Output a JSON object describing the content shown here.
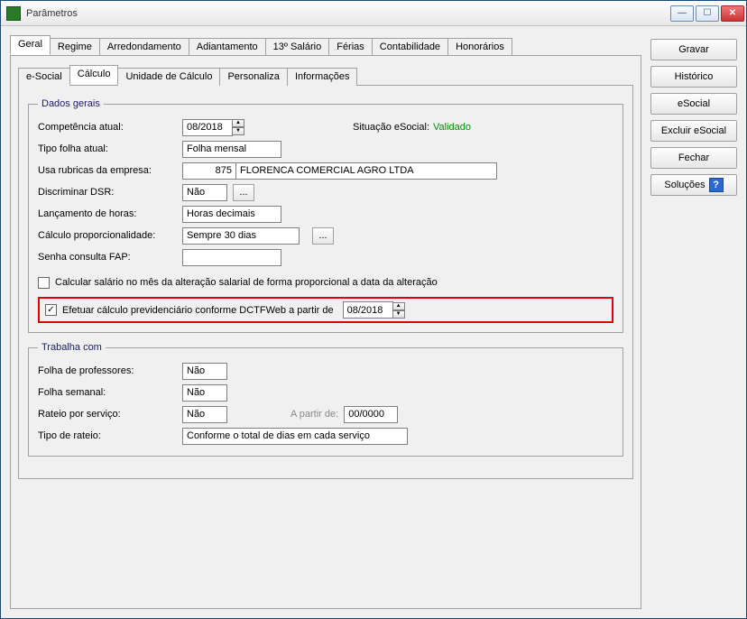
{
  "window": {
    "title": "Parâmetros"
  },
  "tabs": {
    "outer": [
      {
        "label": "Geral",
        "active": true
      },
      {
        "label": "Regime"
      },
      {
        "label": "Arredondamento"
      },
      {
        "label": "Adiantamento"
      },
      {
        "label": "13º Salário"
      },
      {
        "label": "Férias"
      },
      {
        "label": "Contabilidade"
      },
      {
        "label": "Honorários"
      }
    ],
    "inner": [
      {
        "label": "e-Social"
      },
      {
        "label": "Cálculo",
        "active": true
      },
      {
        "label": "Unidade de Cálculo"
      },
      {
        "label": "Personaliza"
      },
      {
        "label": "Informações"
      }
    ]
  },
  "dados_gerais": {
    "legend": "Dados gerais",
    "competencia_label": "Competência atual:",
    "competencia_value": "08/2018",
    "situacao_label": "Situação eSocial:",
    "situacao_value": "Validado",
    "tipo_folha_label": "Tipo folha atual:",
    "tipo_folha_value": "Folha mensal",
    "usa_rubricas_label": "Usa rubricas da empresa:",
    "usa_rubricas_codigo": "875",
    "usa_rubricas_nome": "FLORENCA COMERCIAL AGRO LTDA",
    "discriminar_dsr_label": "Discriminar DSR:",
    "discriminar_dsr_value": "Não",
    "lanc_horas_label": "Lançamento de horas:",
    "lanc_horas_value": "Horas decimais",
    "calc_prop_label": "Cálculo proporcionalidade:",
    "calc_prop_value": "Sempre 30 dias",
    "senha_fap_label": "Senha consulta FAP:",
    "senha_fap_value": "",
    "chk1_label": "Calcular salário no mês da alteração salarial de forma proporcional a data da alteração",
    "chk1_checked": false,
    "chk2_label": "Efetuar cálculo previdenciário conforme DCTFWeb a partir de",
    "chk2_checked": true,
    "chk2_date": "08/2018"
  },
  "trabalha_com": {
    "legend": "Trabalha com",
    "folha_prof_label": "Folha de professores:",
    "folha_prof_value": "Não",
    "folha_sem_label": "Folha semanal:",
    "folha_sem_value": "Não",
    "rateio_serv_label": "Rateio por serviço:",
    "rateio_serv_value": "Não",
    "a_partir_label": "A partir de:",
    "a_partir_value": "00/0000",
    "tipo_rateio_label": "Tipo de rateio:",
    "tipo_rateio_value": "Conforme o total de dias em cada serviço"
  },
  "side_buttons": {
    "gravar": "Gravar",
    "historico": "Histórico",
    "esocial": "eSocial",
    "excluir_esocial": "Excluir eSocial",
    "fechar": "Fechar",
    "solucoes": "Soluções"
  }
}
